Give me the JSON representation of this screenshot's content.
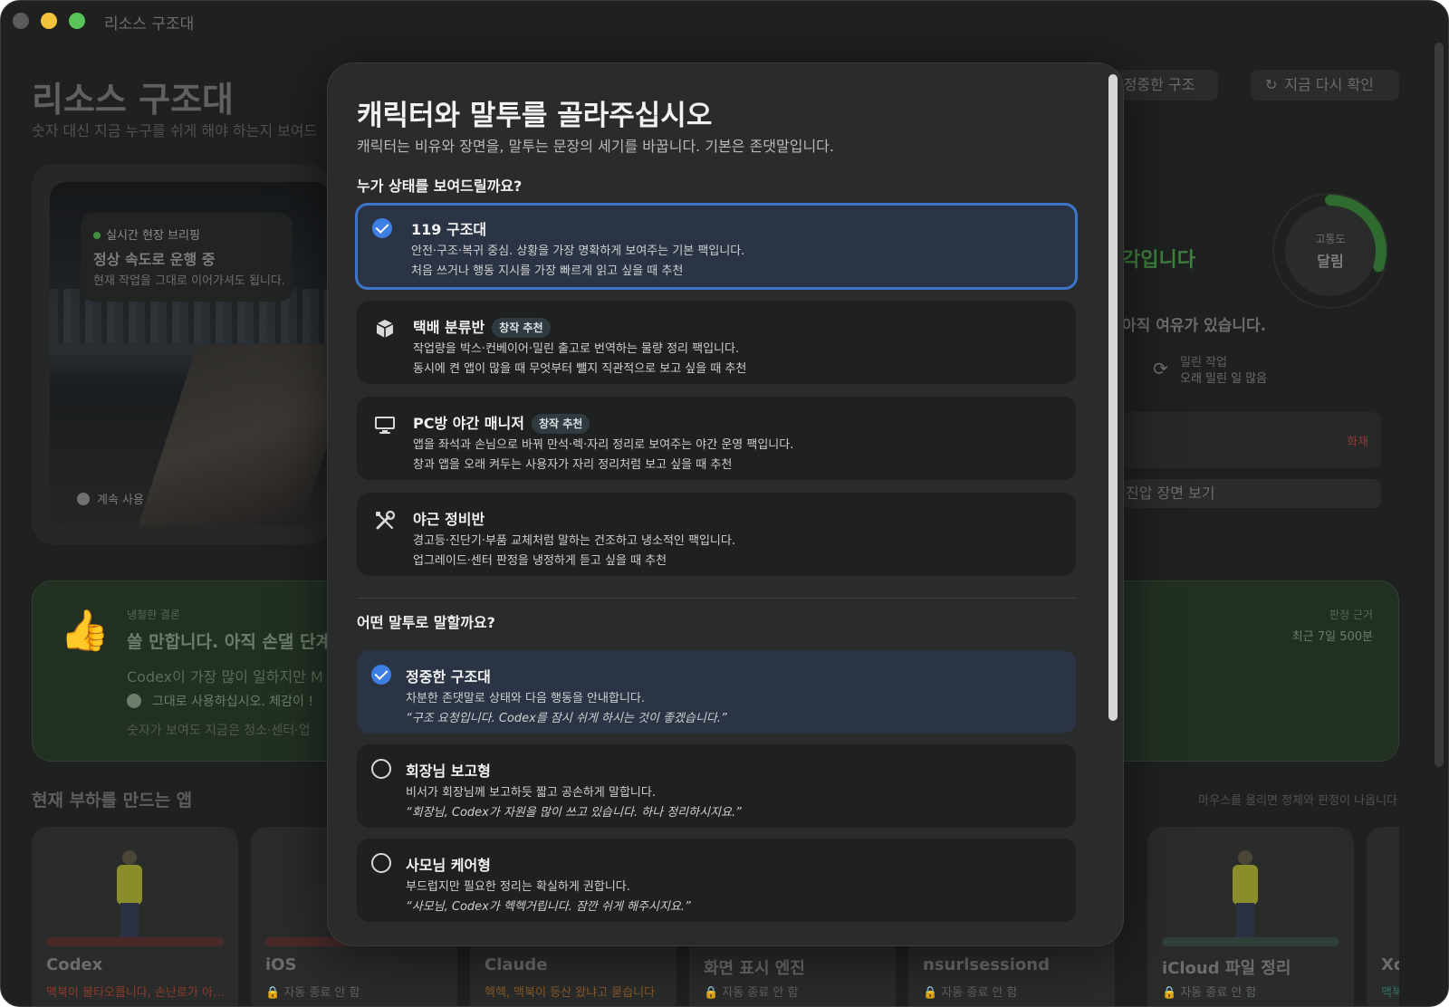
{
  "window": {
    "title": "리소스 구조대"
  },
  "background": {
    "title": "리소스 구조대",
    "subtitle": "숫자 대신 지금 누구를 쉬게 해야 하는지 보여드",
    "persona_pill": "l · 정중한 구조대",
    "recheck_button": "지금 다시 확인",
    "briefing": {
      "tag": "실시간 현장 브리핑",
      "main": "정상 속도로 운행 중",
      "sub": "현재 작업을 그대로 이어가셔도 됩니다."
    },
    "keep_using": "계속 사용",
    "status_text": "각입니다",
    "gauge": {
      "label": "고통도",
      "value": "달림",
      "level": 0.3
    },
    "spare_text": "아직 여유가 있습니다.",
    "pending": {
      "title": "밀린 작업",
      "sub": "오래 밀린 일 많음"
    },
    "fire_label": "화재",
    "suppress_button": "진압 장면 보기",
    "verdict": {
      "tag": "냉철한 결론",
      "main": "쓸 만합니다. 아직 손댈 단계",
      "line": "Codex이 가장 많이 일하지만 M",
      "action": "그대로 사용하십시오. 체감이 !",
      "foot": "숫자가 보여도 지금은 청소·센터·업",
      "basis_tag": "판정 근거",
      "basis": "최근 7일 500분"
    },
    "apps_title": "현재 부하를 만드는 앱",
    "apps_hint": "마우스를 올리면 정체와 판정이 나옵니다",
    "apps": [
      {
        "name": "Codex",
        "status": "맥북이 불타오릅니다, 손난로가 아…"
      },
      {
        "name": "iOS",
        "status": "🔒 자동 종료 안 함"
      },
      {
        "name": "Claude",
        "status": "헥헥, 맥북이 등산 왔냐고 묻습니다"
      },
      {
        "name": "화면 표시 엔진",
        "status": "🔒 자동 종료 안 함"
      },
      {
        "name": "nsurlsessiond",
        "status": "🔒 자동 종료 안 함"
      },
      {
        "name": "iCloud 파일 정리",
        "status": "🔒 자동 종료 안 함"
      },
      {
        "name": "Xc",
        "status": "맥북"
      }
    ]
  },
  "modal": {
    "title": "캐릭터와 말투를 골라주십시오",
    "subtitle": "캐릭터는 비유와 장면을, 말투는 문장의 세기를 바꿉니다. 기본은 존댓말입니다.",
    "character_section": "누가 상태를 보여드릴까요?",
    "tone_section": "어떤 말투로 말할까요?",
    "characters": [
      {
        "title": "119 구조대",
        "badge": "",
        "desc": "안전·구조·복귀 중심. 상황을 가장 명확하게 보여주는 기본 팩입니다.",
        "rec": "처음 쓰거나 행동 지시를 가장 빠르게 읽고 싶을 때 추천",
        "icon": "check-icon"
      },
      {
        "title": "택배 분류반",
        "badge": "창작 추천",
        "desc": "작업량을 박스·컨베이어·밀린 출고로 번역하는 물량 정리 팩입니다.",
        "rec": "동시에 켠 앱이 많을 때 무엇부터 뺄지 직관적으로 보고 싶을 때 추천",
        "icon": "package-icon"
      },
      {
        "title": "PC방 야간 매니저",
        "badge": "창작 추천",
        "desc": "앱을 좌석과 손님으로 바꿔 만석·렉·자리 정리로 보여주는 야간 운영 팩입니다.",
        "rec": "창과 앱을 오래 켜두는 사용자가 자리 정리처럼 보고 싶을 때 추천",
        "icon": "monitor-icon"
      },
      {
        "title": "야근 정비반",
        "badge": "",
        "desc": "경고등·진단기·부품 교체처럼 말하는 건조하고 냉소적인 팩입니다.",
        "rec": "업그레이드·센터 판정을 냉정하게 듣고 싶을 때 추천",
        "icon": "tools-icon"
      }
    ],
    "tones": [
      {
        "title": "정중한 구조대",
        "desc": "차분한 존댓말로 상태와 다음 행동을 안내합니다.",
        "quote": "“구조 요청입니다. Codex를 잠시 쉬게 하시는 것이 좋겠습니다.”"
      },
      {
        "title": "회장님 보고형",
        "desc": "비서가 회장님께 보고하듯 짧고 공손하게 말합니다.",
        "quote": "“회장님, Codex가 자원을 많이 쓰고 있습니다. 하나 정리하시지요.”"
      },
      {
        "title": "사모님 케어형",
        "desc": "부드럽지만 필요한 정리는 확실하게 권합니다.",
        "quote": "“사모님, Codex가 헥헥거립니다. 잠깐 쉬게 해주시지요.”"
      }
    ]
  }
}
